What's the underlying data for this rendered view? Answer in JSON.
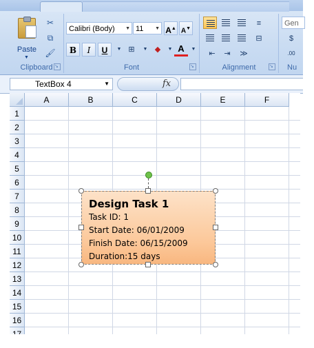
{
  "ribbon": {
    "clipboard": {
      "paste_label": "Paste",
      "group_label": "Clipboard"
    },
    "font": {
      "font_name": "Calibri (Body)",
      "font_size": "11",
      "grow_label": "A",
      "shrink_label": "A",
      "bold_label": "B",
      "italic_label": "I",
      "underline_label": "U",
      "font_color_label": "A",
      "group_label": "Font"
    },
    "alignment": {
      "group_label": "Alignment"
    },
    "number": {
      "format_label": "Gen",
      "currency_label": "$",
      "group_label": "Nu"
    }
  },
  "formula_bar": {
    "name_box_value": "TextBox 4",
    "fx_label": "fx",
    "formula_value": ""
  },
  "grid": {
    "columns": [
      "A",
      "B",
      "C",
      "D",
      "E",
      "F"
    ],
    "rows": [
      "1",
      "2",
      "3",
      "4",
      "5",
      "6",
      "7",
      "8",
      "9",
      "10",
      "11",
      "12",
      "13",
      "14",
      "15",
      "16",
      "17"
    ]
  },
  "textbox": {
    "title": "Design Task 1",
    "lines": [
      "Task ID: 1",
      "Start Date: 06/01/2009",
      "Finish Date: 06/15/2009",
      "Duration:15 days"
    ]
  },
  "colors": {
    "textbox_fill_top": "#fde2c8",
    "textbox_fill_bottom": "#f8b780",
    "rotate_handle": "#6fc24a",
    "ribbon_active": "#ffc553"
  }
}
